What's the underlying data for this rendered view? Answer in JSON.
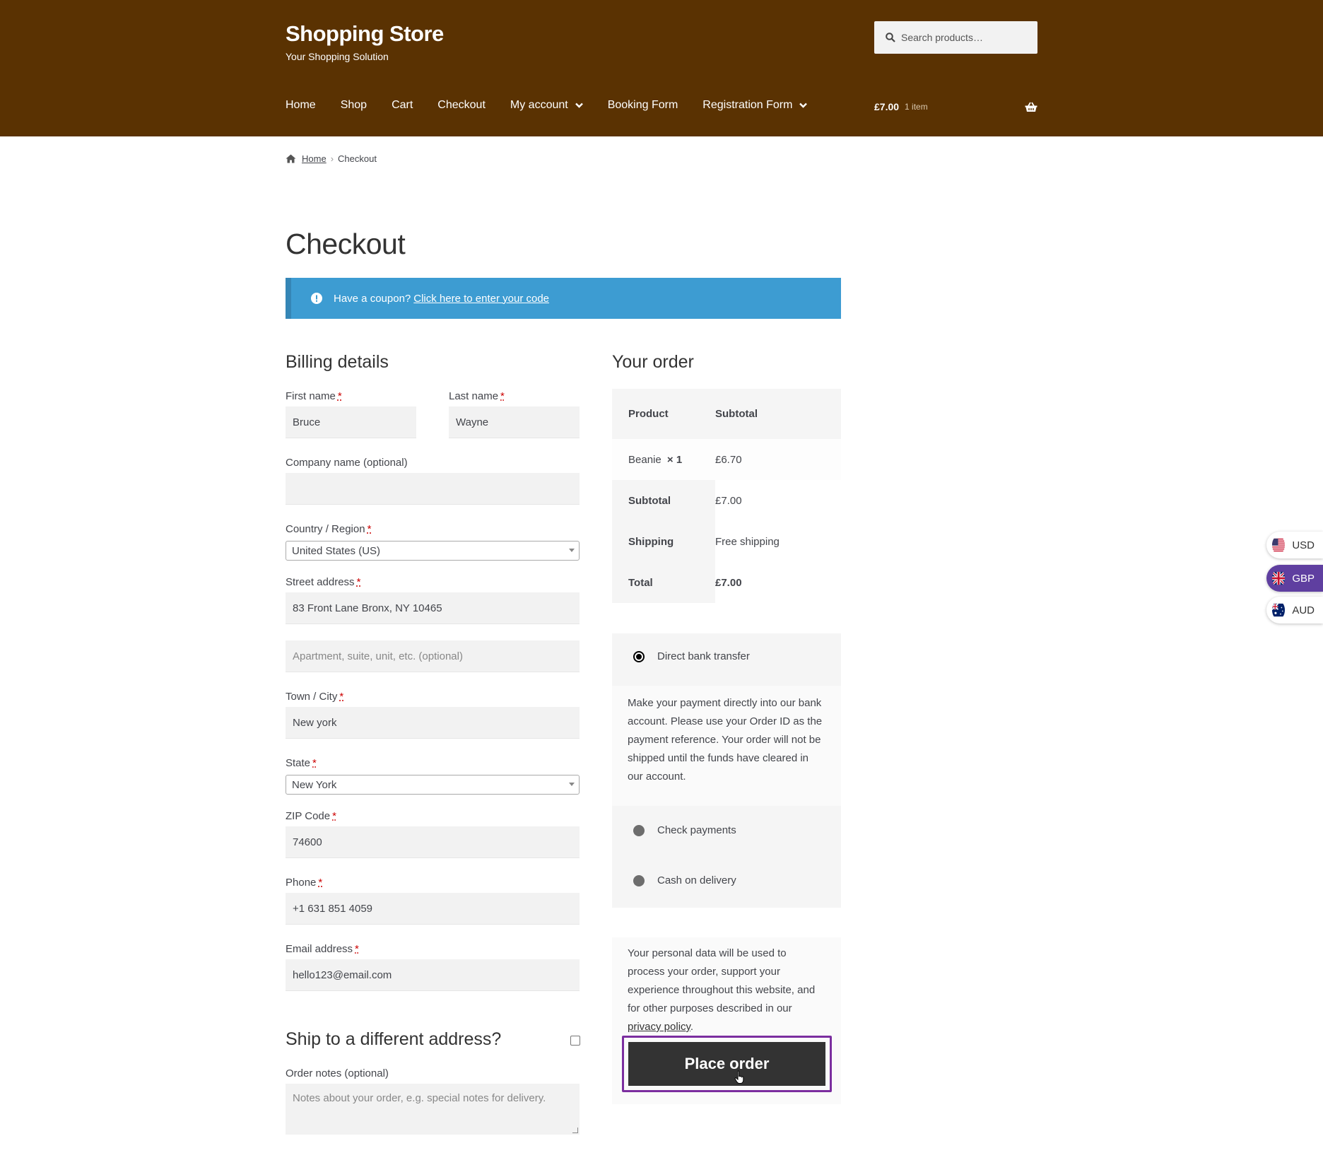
{
  "site": {
    "title": "Shopping Store",
    "tagline": "Your Shopping Solution"
  },
  "search": {
    "placeholder": "Search products…"
  },
  "nav": [
    "Home",
    "Shop",
    "Cart",
    "Checkout",
    "My account",
    "Booking Form",
    "Registration Form"
  ],
  "cart": {
    "amount": "£7.00",
    "count": "1 item"
  },
  "breadcrumb": {
    "home": "Home",
    "current": "Checkout"
  },
  "page_title": "Checkout",
  "notice": {
    "text": "Have a coupon?",
    "link": "Click here to enter your code"
  },
  "billing": {
    "heading": "Billing details",
    "first_name_label": "First name",
    "first_name": "Bruce",
    "last_name_label": "Last name",
    "last_name": "Wayne",
    "company_label": "Company name (optional)",
    "company": "",
    "country_label": "Country / Region",
    "country": "United States (US)",
    "street_label": "Street address",
    "street": "83 Front Lane Bronx, NY 10465",
    "apt_placeholder": "Apartment, suite, unit, etc. (optional)",
    "city_label": "Town / City",
    "city": "New york",
    "state_label": "State",
    "state": "New York",
    "zip_label": "ZIP Code",
    "zip": "74600",
    "phone_label": "Phone",
    "phone": "+1 631 851 4059",
    "email_label": "Email address",
    "email": "hello123@email.com",
    "req_mark": "*"
  },
  "ship_heading": "Ship to a different address?",
  "notes": {
    "label": "Order notes (optional)",
    "placeholder": "Notes about your order, e.g. special notes for delivery."
  },
  "order": {
    "heading": "Your order",
    "col_product": "Product",
    "col_subtotal": "Subtotal",
    "item_name": "Beanie",
    "item_qty": "× 1",
    "item_price": "£6.70",
    "subtotal_label": "Subtotal",
    "subtotal": "£7.00",
    "shipping_label": "Shipping",
    "shipping": "Free shipping",
    "total_label": "Total",
    "total": "£7.00"
  },
  "payment": {
    "bank": "Direct bank transfer",
    "bank_desc": "Make your payment directly into our bank account. Please use your Order ID as the payment reference. Your order will not be shipped until the funds have cleared in our account.",
    "check": "Check payments",
    "cod": "Cash on delivery"
  },
  "privacy": {
    "text": "Your personal data will be used to process your order, support your experience throughout this website, and for other purposes described in our",
    "link": "privacy policy",
    "end": "."
  },
  "place_order": "Place order",
  "currencies": [
    {
      "code": "USD"
    },
    {
      "code": "GBP",
      "selected": true
    },
    {
      "code": "AUD"
    }
  ],
  "colors": {
    "header": "#5a3202",
    "notice": "#3d9cd2",
    "highlight": "#7b2e9f"
  }
}
